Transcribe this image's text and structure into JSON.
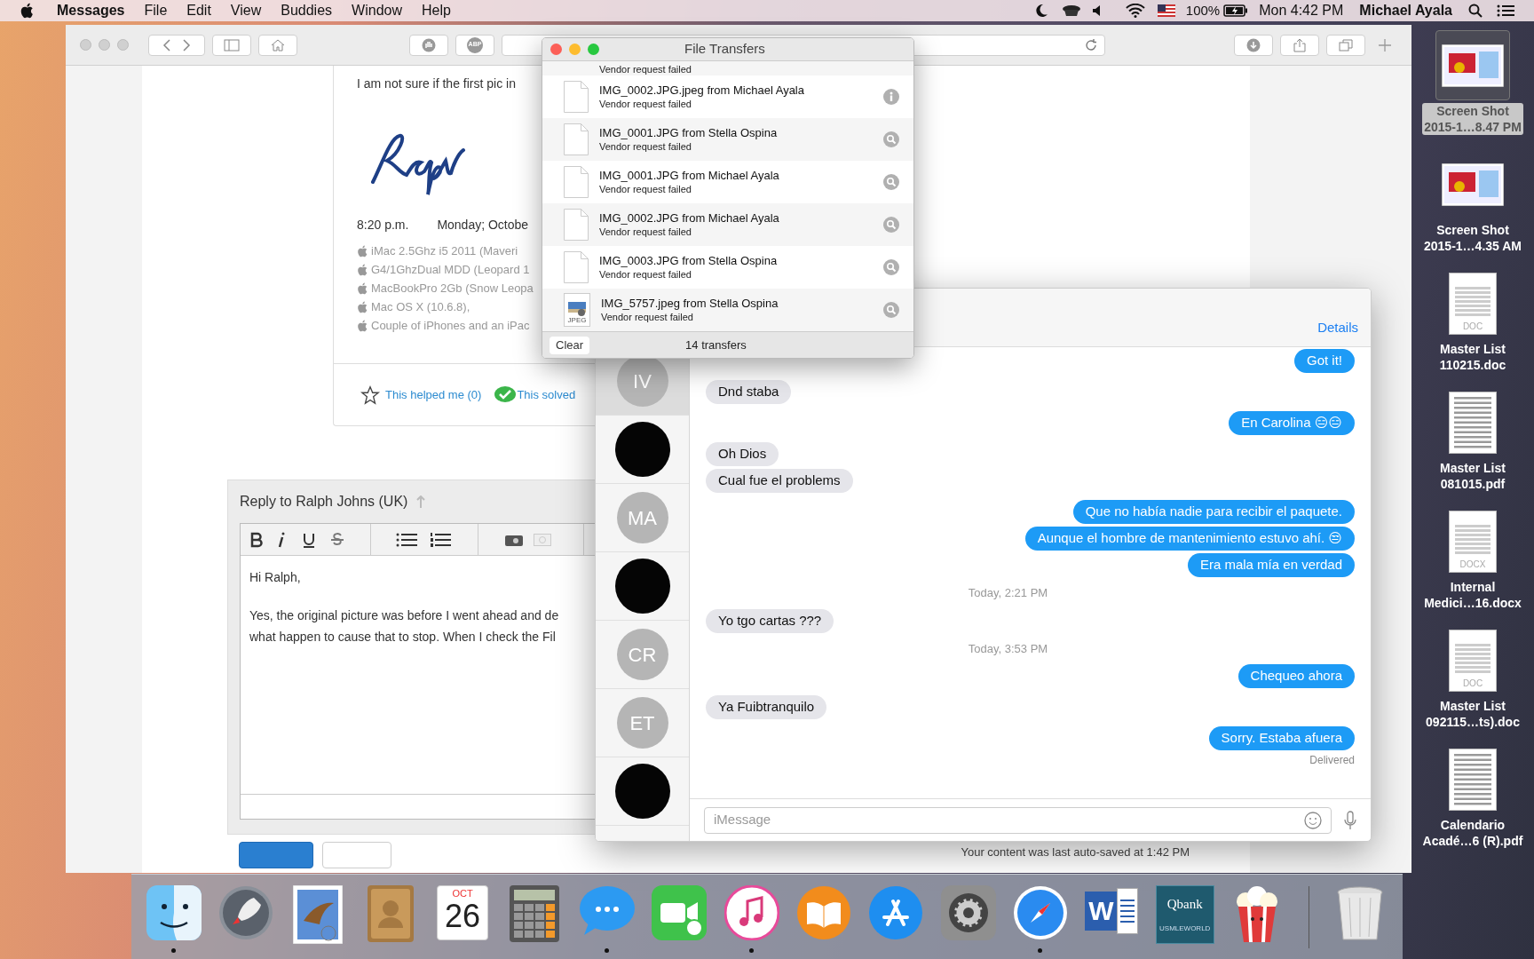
{
  "menu_bar": {
    "app": "Messages",
    "menus": [
      "File",
      "Edit",
      "View",
      "Buddies",
      "Window",
      "Help"
    ],
    "battery": "100%",
    "clock": "Mon 4:42 PM",
    "user": "Michael Ayala"
  },
  "browser": {
    "toolbar": {
      "adblock": "ABP"
    },
    "post": {
      "text": "I am not sure if the first pic in",
      "time": "8:20 p.m.",
      "date": "Monday; Octobe",
      "specs": [
        "iMac 2.5Ghz i5 2011 (Maveri",
        "G4/1GhzDual MDD (Leopard 1",
        "MacBookPro 2Gb (Snow Leopa",
        "Mac OS X (10.6.8),",
        "Couple of iPhones and an iPac"
      ],
      "helped": "This helped me",
      "helped_count": "(0)",
      "solved": "This solved"
    },
    "reply": {
      "title": "Reply to Ralph Johns (UK)",
      "body": [
        "Hi Ralph,",
        "Yes, the original picture was before I went ahead and de",
        "what happen to cause that to stop. When I check the Fil"
      ]
    },
    "autosave": "Your content was last auto-saved at 1:42 PM"
  },
  "file_transfers": {
    "title": "File Transfers",
    "partial_status": "Vendor request failed",
    "rows": [
      {
        "name": "IMG_0002.JPG.jpeg from Michael Ayala",
        "status": "Vendor request failed",
        "kind": "info"
      },
      {
        "name": "IMG_0001.JPG from Stella Ospina",
        "status": "Vendor request failed",
        "kind": "file"
      },
      {
        "name": "IMG_0001.JPG from Michael Ayala",
        "status": "Vendor request failed",
        "kind": "file"
      },
      {
        "name": "IMG_0002.JPG from Michael Ayala",
        "status": "Vendor request failed",
        "kind": "file"
      },
      {
        "name": "IMG_0003.JPG from Stella Ospina",
        "status": "Vendor request failed",
        "kind": "file"
      },
      {
        "name": "IMG_5757.jpeg from Stella Ospina",
        "status": "Vendor request failed",
        "kind": "image",
        "badge": "JPEG"
      }
    ],
    "clear": "Clear",
    "count": "14 transfers"
  },
  "messages": {
    "details": "Details",
    "conversations": [
      {
        "kind": "initials",
        "initials": "IV",
        "selected": true
      },
      {
        "kind": "photo",
        "selected": false
      },
      {
        "kind": "initials",
        "initials": "MA",
        "selected": false
      },
      {
        "kind": "photo",
        "selected": false
      },
      {
        "kind": "initials",
        "initials": "CR",
        "selected": false
      },
      {
        "kind": "initials",
        "initials": "ET",
        "selected": false
      },
      {
        "kind": "photo",
        "selected": false
      }
    ],
    "thread": [
      {
        "kind": "sent",
        "text": "Got it!"
      },
      {
        "kind": "received",
        "text": "Dnd staba"
      },
      {
        "kind": "sent",
        "text": "En Carolina 😑😑"
      },
      {
        "kind": "received",
        "text": "Oh Dios"
      },
      {
        "kind": "received",
        "text": "Cual fue el problems"
      },
      {
        "kind": "sent",
        "text": "Que no había nadie para recibir el paquete."
      },
      {
        "kind": "sent",
        "text": "Aunque el hombre de mantenimiento estuvo ahí. 😒"
      },
      {
        "kind": "sent",
        "text": "Era mala mía en verdad"
      },
      {
        "kind": "timestamp",
        "text": "Today, 2:21 PM"
      },
      {
        "kind": "received",
        "text": "Yo tgo cartas ???"
      },
      {
        "kind": "timestamp",
        "text": "Today, 3:53 PM"
      },
      {
        "kind": "sent",
        "text": "Chequeo ahora"
      },
      {
        "kind": "received",
        "text": "Ya Fuibtranquilo"
      },
      {
        "kind": "sent",
        "text": "Sorry. Estaba afuera"
      }
    ],
    "delivered": "Delivered",
    "input": {
      "placeholder": "iMessage"
    }
  },
  "desktop_icons": [
    {
      "kind": "screenshot",
      "label": [
        "Screen Shot",
        "2015-1…8.47 PM"
      ],
      "selected": true
    },
    {
      "kind": "screenshot",
      "label": [
        "Screen Shot",
        "2015-1…4.35 AM"
      ],
      "selected": false
    },
    {
      "kind": "document",
      "badge": "DOC",
      "label": [
        "Master List",
        "110215.doc"
      ],
      "selected": false
    },
    {
      "kind": "pdf",
      "label": [
        "Master List",
        "081015.pdf"
      ],
      "selected": false
    },
    {
      "kind": "document",
      "badge": "DOCX",
      "label": [
        "Internal",
        "Medici…16.docx"
      ],
      "selected": false
    },
    {
      "kind": "document",
      "badge": "DOC",
      "label": [
        "Master List",
        "092115…ts).doc"
      ],
      "selected": false
    },
    {
      "kind": "pdf",
      "label": [
        "Calendario",
        "Acadé…6 (R).pdf"
      ],
      "selected": false
    }
  ],
  "dock": [
    {
      "kind": "finder",
      "running": true
    },
    {
      "kind": "launchpad",
      "running": false
    },
    {
      "kind": "mail",
      "running": false
    },
    {
      "kind": "contacts",
      "running": false
    },
    {
      "kind": "calendar",
      "month": "OCT",
      "day": "26",
      "running": false
    },
    {
      "kind": "calculator",
      "running": false
    },
    {
      "kind": "messages",
      "running": true
    },
    {
      "kind": "facetime",
      "running": false
    },
    {
      "kind": "itunes",
      "running": true
    },
    {
      "kind": "ibooks",
      "running": false
    },
    {
      "kind": "appstore",
      "running": false
    },
    {
      "kind": "preferences",
      "running": false
    },
    {
      "kind": "safari",
      "running": true
    },
    {
      "kind": "word",
      "letter": "W",
      "running": false
    },
    {
      "kind": "qbank",
      "title": "Qbank",
      "subtitle": "USMLEWORLD",
      "running": false
    },
    {
      "kind": "popcorn",
      "running": false
    },
    {
      "kind": "separator"
    },
    {
      "kind": "trash",
      "running": false
    }
  ]
}
